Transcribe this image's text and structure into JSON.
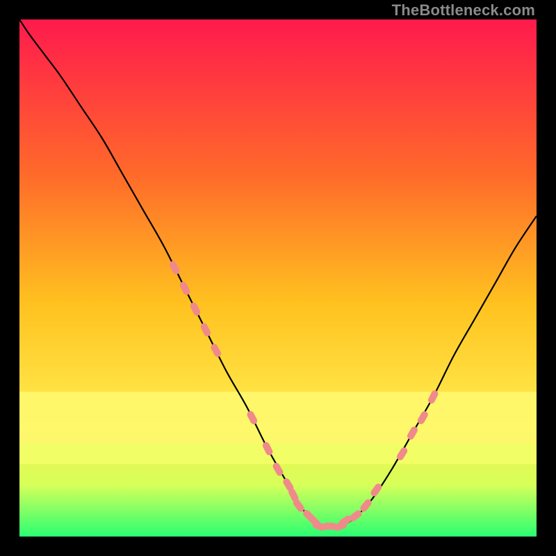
{
  "watermark": "TheBottleneck.com",
  "chart_data": {
    "type": "line",
    "title": "",
    "xlabel": "",
    "ylabel": "",
    "xlim": [
      0,
      100
    ],
    "ylim": [
      0,
      100
    ],
    "grid": false,
    "legend": false,
    "gradient_stops": [
      {
        "offset": 0.0,
        "color": "#ff1a4d"
      },
      {
        "offset": 0.3,
        "color": "#ff6a2a"
      },
      {
        "offset": 0.55,
        "color": "#ffc21f"
      },
      {
        "offset": 0.75,
        "color": "#ffe84a"
      },
      {
        "offset": 0.9,
        "color": "#d7ff59"
      },
      {
        "offset": 1.0,
        "color": "#2aff71"
      }
    ],
    "series": [
      {
        "name": "curve",
        "color": "#000000",
        "x": [
          0,
          2,
          5,
          8,
          12,
          16,
          20,
          24,
          28,
          32,
          36,
          40,
          44,
          48,
          52,
          55,
          57,
          59,
          61,
          64,
          68,
          72,
          76,
          80,
          84,
          88,
          92,
          96,
          100
        ],
        "y": [
          100,
          97,
          93,
          89,
          83,
          77,
          70,
          63,
          56,
          48,
          40,
          32,
          25,
          17,
          10,
          5,
          3,
          2,
          2,
          3,
          7,
          13,
          20,
          27,
          35,
          42,
          49,
          56,
          62
        ]
      },
      {
        "name": "markers",
        "type": "scatter",
        "color": "#f08a8a",
        "points": [
          {
            "x": 30,
            "y": 52
          },
          {
            "x": 32,
            "y": 48
          },
          {
            "x": 34,
            "y": 44
          },
          {
            "x": 36,
            "y": 40
          },
          {
            "x": 38,
            "y": 36
          },
          {
            "x": 45,
            "y": 23
          },
          {
            "x": 48,
            "y": 17
          },
          {
            "x": 50,
            "y": 13
          },
          {
            "x": 52,
            "y": 10
          },
          {
            "x": 53,
            "y": 8
          },
          {
            "x": 54,
            "y": 6
          },
          {
            "x": 56,
            "y": 4
          },
          {
            "x": 57,
            "y": 3
          },
          {
            "x": 58,
            "y": 2
          },
          {
            "x": 60,
            "y": 2
          },
          {
            "x": 62,
            "y": 2
          },
          {
            "x": 63,
            "y": 3
          },
          {
            "x": 65,
            "y": 4
          },
          {
            "x": 67,
            "y": 6
          },
          {
            "x": 69,
            "y": 9
          },
          {
            "x": 74,
            "y": 16
          },
          {
            "x": 76,
            "y": 20
          },
          {
            "x": 78,
            "y": 23
          },
          {
            "x": 80,
            "y": 27
          }
        ]
      }
    ],
    "yellow_bands": [
      {
        "y_from": 72,
        "y_to": 82,
        "color": "#fff970"
      },
      {
        "y_from": 82,
        "y_to": 86,
        "color": "#f3ff6a"
      }
    ]
  }
}
